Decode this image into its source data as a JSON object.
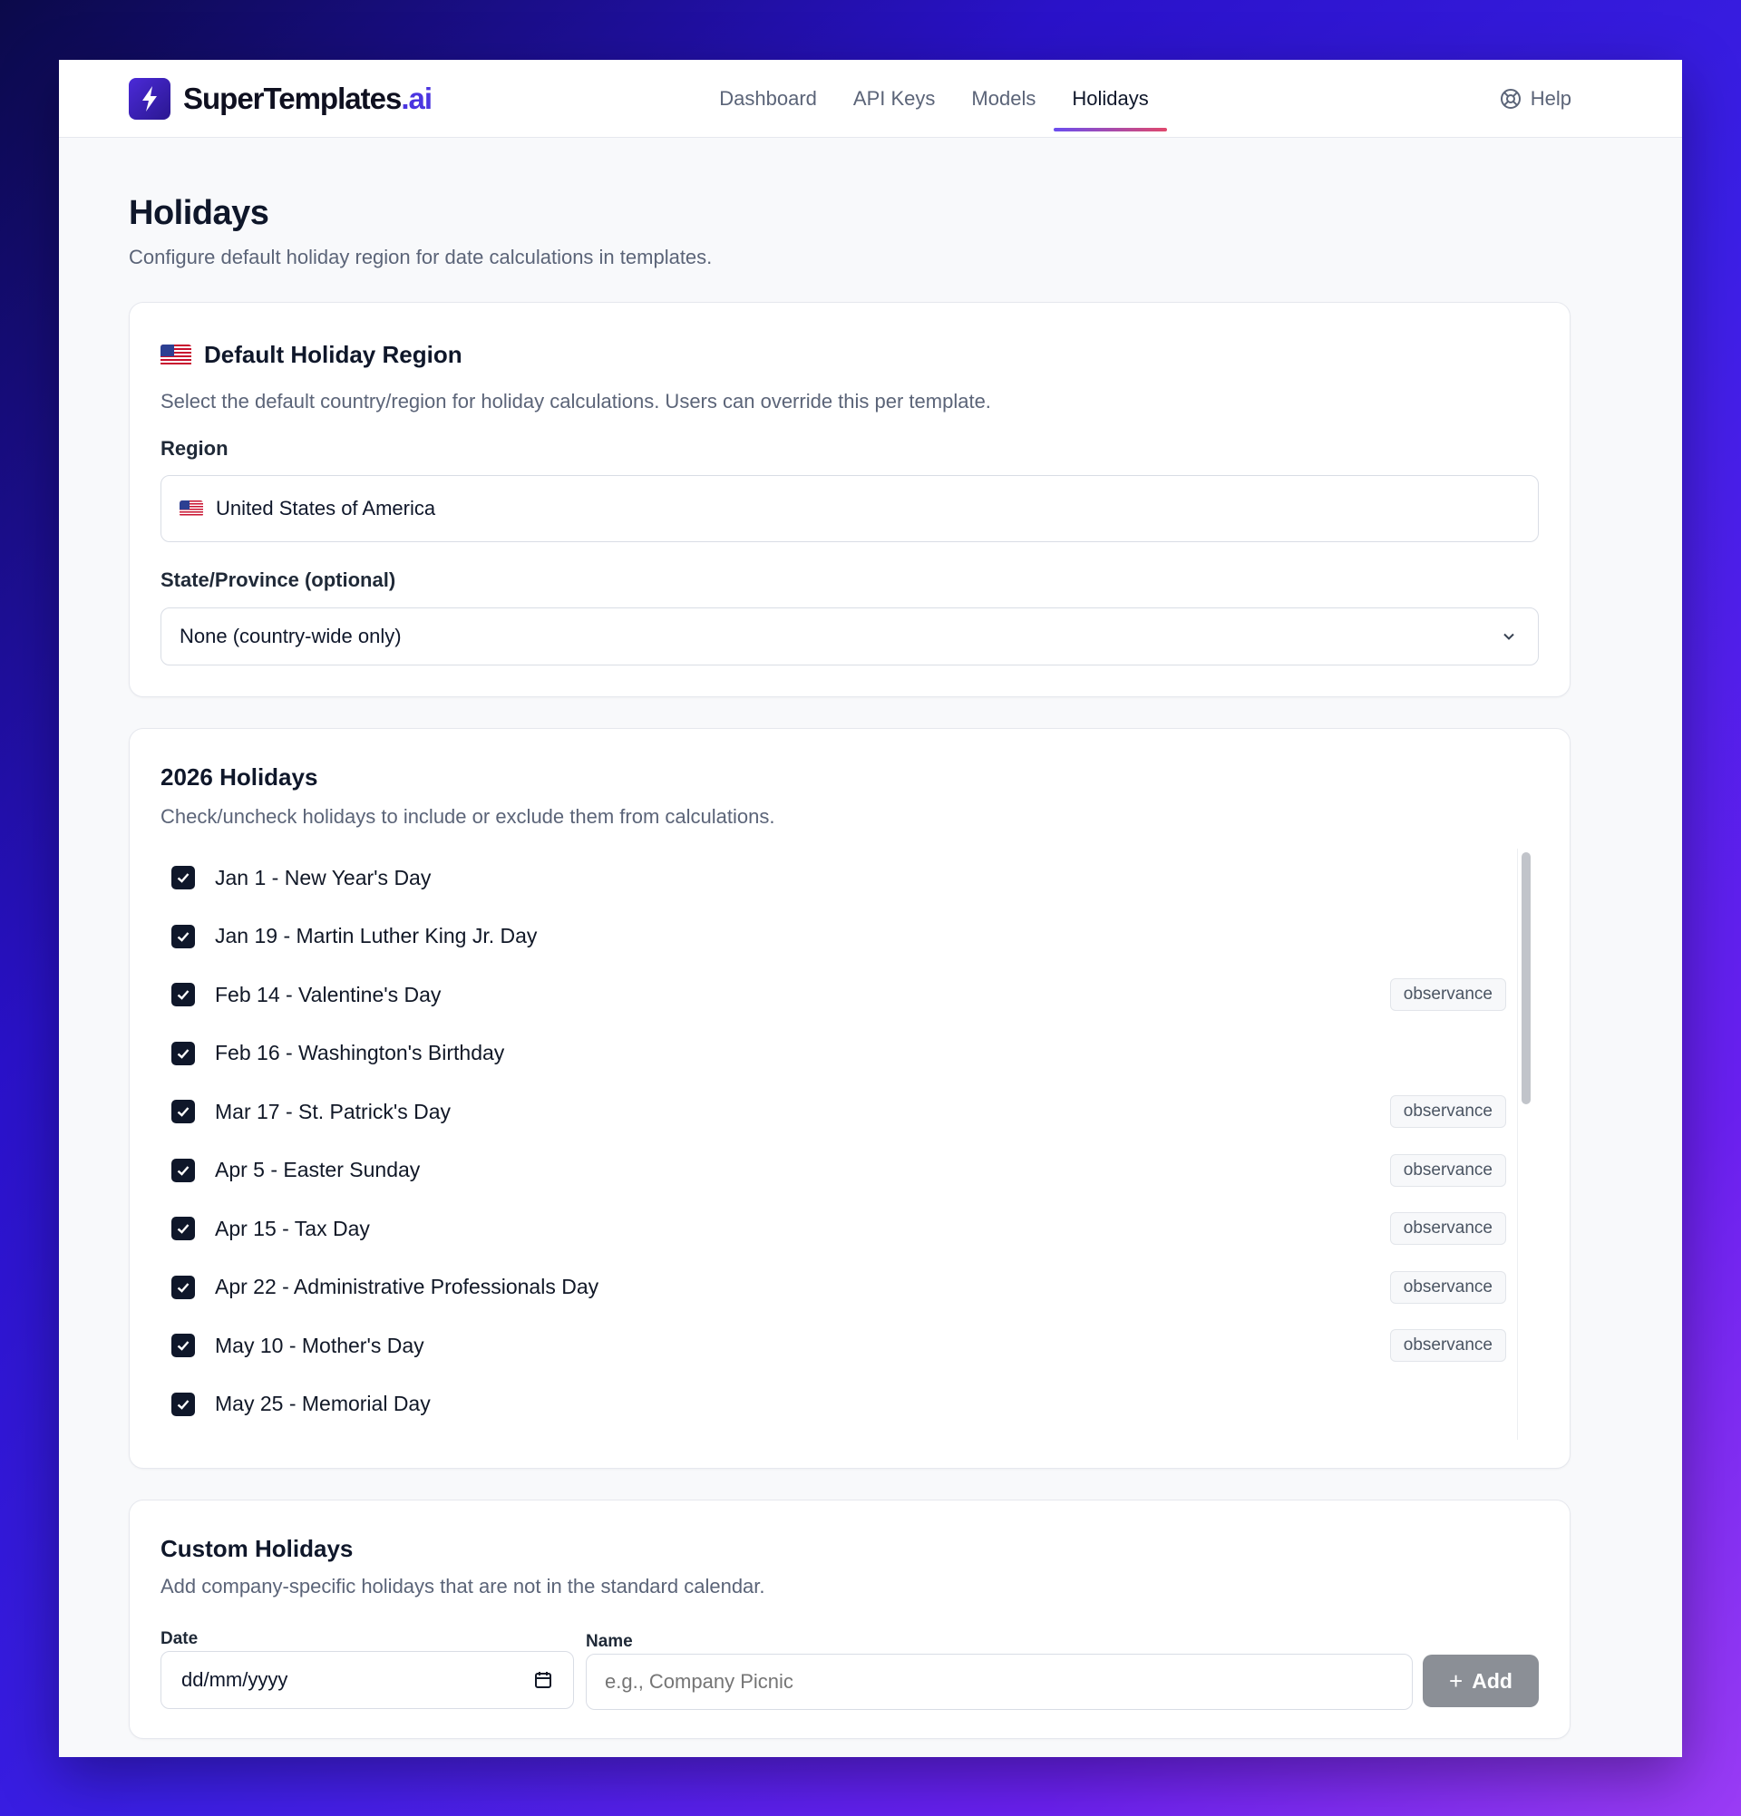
{
  "brand": {
    "name": "SuperTemplates",
    "suffix": ".ai"
  },
  "nav": [
    {
      "label": "Dashboard",
      "active": false
    },
    {
      "label": "API Keys",
      "active": false
    },
    {
      "label": "Models",
      "active": false
    },
    {
      "label": "Holidays",
      "active": true
    }
  ],
  "help_label": "Help",
  "page": {
    "title": "Holidays",
    "subtitle": "Configure default holiday region for date calculations in templates."
  },
  "region_card": {
    "title": "Default Holiday Region",
    "description": "Select the default country/region for holiday calculations. Users can override this per template.",
    "region_label": "Region",
    "region_value": "United States of America",
    "state_label": "State/Province (optional)",
    "state_value": "None (country-wide only)"
  },
  "holidays_card": {
    "title": "2026 Holidays",
    "description": "Check/uncheck holidays to include or exclude them from calculations.",
    "items": [
      {
        "label": "Jan 1 - New Year's Day",
        "checked": true,
        "badge": ""
      },
      {
        "label": "Jan 19 - Martin Luther King Jr. Day",
        "checked": true,
        "badge": ""
      },
      {
        "label": "Feb 14 - Valentine's Day",
        "checked": true,
        "badge": "observance"
      },
      {
        "label": "Feb 16 - Washington's Birthday",
        "checked": true,
        "badge": ""
      },
      {
        "label": "Mar 17 - St. Patrick's Day",
        "checked": true,
        "badge": "observance"
      },
      {
        "label": "Apr 5 - Easter Sunday",
        "checked": true,
        "badge": "observance"
      },
      {
        "label": "Apr 15 - Tax Day",
        "checked": true,
        "badge": "observance"
      },
      {
        "label": "Apr 22 - Administrative Professionals Day",
        "checked": true,
        "badge": "observance"
      },
      {
        "label": "May 10 - Mother's Day",
        "checked": true,
        "badge": "observance"
      },
      {
        "label": "May 25 - Memorial Day",
        "checked": true,
        "badge": ""
      }
    ]
  },
  "custom_card": {
    "title": "Custom Holidays",
    "description": "Add company-specific holidays that are not in the standard calendar.",
    "date_label": "Date",
    "date_placeholder": "dd/mm/yyyy",
    "name_label": "Name",
    "name_placeholder": "e.g., Company Picnic",
    "add_label": "Add"
  },
  "colors": {
    "accent": "#4b35e0",
    "checkbox": "#0f172a",
    "add_button": "#8b8f96"
  }
}
